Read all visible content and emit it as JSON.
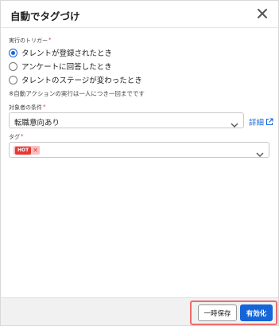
{
  "dialog": {
    "title": "自動でタグづけ",
    "close_icon": "close-icon"
  },
  "trigger": {
    "label": "実行のトリガー",
    "required_mark": "*",
    "options": [
      {
        "label": "タレントが登録されたとき",
        "checked": true
      },
      {
        "label": "アンケートに回答したとき",
        "checked": false
      },
      {
        "label": "タレントのステージが変わったとき",
        "checked": false
      }
    ],
    "note": "※自動アクションの実行は一人につき一回までです"
  },
  "condition": {
    "label": "対象者の条件",
    "required_mark": "*",
    "value": "転職意向あり",
    "detail_link": "詳細"
  },
  "tag": {
    "label": "タグ",
    "required_mark": "*",
    "chips": [
      {
        "label": "HOT",
        "color": "#e53935"
      }
    ]
  },
  "footer": {
    "save_draft_label": "一時保存",
    "enable_label": "有効化"
  },
  "colors": {
    "primary": "#1565d8",
    "required": "#e53935",
    "highlight": "#ef6b6b"
  }
}
